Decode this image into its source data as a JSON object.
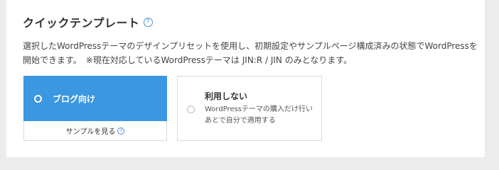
{
  "section": {
    "title": "クイックテンプレート",
    "help_glyph": "?",
    "description": "選択したWordPressテーマのデザインプリセットを使用し、初期設定やサンプルページ構成済みの状態でWordPressを開始できます。　※現在対応しているWordPressテーマは JIN:R / JIN のみとなります。"
  },
  "options": [
    {
      "label": "ブログ向け",
      "selected": true,
      "sample_link": "サンプルを見る",
      "sample_help_glyph": "?"
    },
    {
      "label": "利用しない",
      "selected": false,
      "description": "WordPressテーマの購入だけ行い あとで自分で適用する"
    }
  ],
  "colors": {
    "accent": "#3b97e0",
    "help_icon": "#4f8fd6",
    "background": "#ececec"
  },
  "icons": {
    "title_help": "question-circle-icon",
    "sample_help": "question-circle-icon",
    "radio_selected": "radio-selected-icon",
    "radio_unselected": "radio-unselected-icon"
  }
}
